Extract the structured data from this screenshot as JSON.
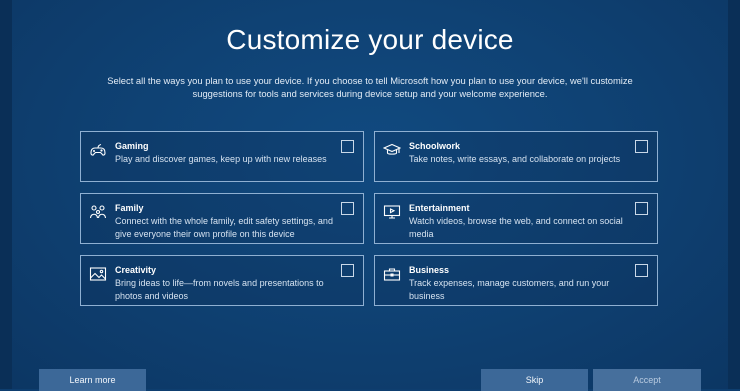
{
  "page": {
    "title": "Customize your device",
    "subtitle": "Select all the ways you plan to use your device. If you choose to tell Microsoft how you plan to use your device, we'll customize suggestions for tools and services during device setup and your welcome experience."
  },
  "options": [
    {
      "key": "gaming",
      "icon": "gamepad-icon",
      "title": "Gaming",
      "description": "Play and discover games, keep up with new releases",
      "checked": false
    },
    {
      "key": "schoolwork",
      "icon": "graduation-cap-icon",
      "title": "Schoolwork",
      "description": "Take notes, write essays, and collaborate on projects",
      "checked": false
    },
    {
      "key": "family",
      "icon": "family-icon",
      "title": "Family",
      "description": "Connect with the whole family, edit safety settings, and give everyone their own profile on this device",
      "checked": false
    },
    {
      "key": "entertainment",
      "icon": "monitor-icon",
      "title": "Entertainment",
      "description": "Watch videos, browse the web, and connect on social media",
      "checked": false
    },
    {
      "key": "creativity",
      "icon": "image-icon",
      "title": "Creativity",
      "description": "Bring ideas to life—from novels and presentations to photos and videos",
      "checked": false
    },
    {
      "key": "business",
      "icon": "briefcase-icon",
      "title": "Business",
      "description": "Track expenses, manage customers, and run your business",
      "checked": false
    }
  ],
  "buttons": {
    "learn_more": "Learn more",
    "skip": "Skip",
    "accept": "Accept"
  },
  "colors": {
    "background": "#0f4274",
    "card_border": "#8fb0d2",
    "button": "#3c6898"
  }
}
